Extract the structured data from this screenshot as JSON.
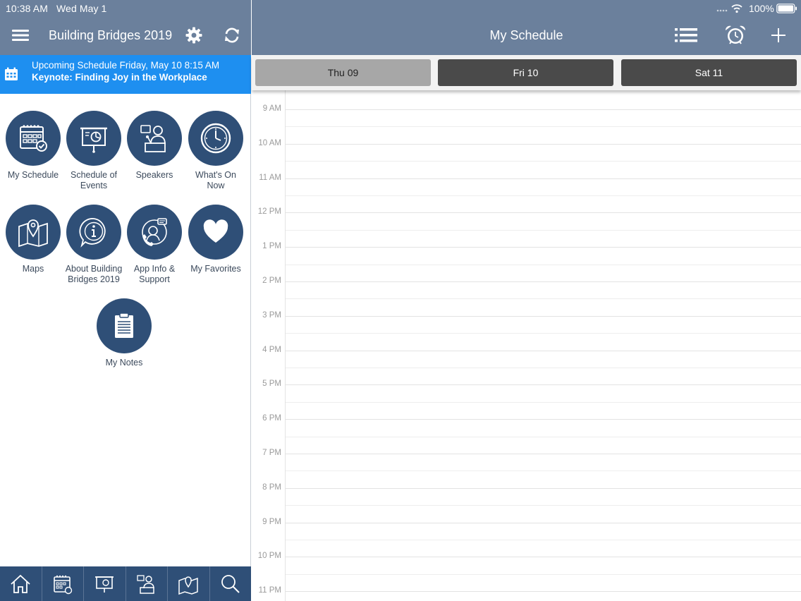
{
  "status_bar": {
    "time": "10:38 AM",
    "date": "Wed May 1",
    "battery": "100%"
  },
  "left_panel": {
    "app_title": "Building Bridges 2019",
    "banner": {
      "line1": "Upcoming Schedule Friday, May 10 8:15 AM",
      "line2": "Keynote: Finding Joy in the Workplace"
    },
    "tiles": [
      {
        "label": "My Schedule",
        "icon": "calendar-check-icon"
      },
      {
        "label": "Schedule of Events",
        "icon": "presentation-board-icon"
      },
      {
        "label": "Speakers",
        "icon": "speaker-podium-icon"
      },
      {
        "label": "What's On Now",
        "icon": "clock-icon"
      },
      {
        "label": "Maps",
        "icon": "map-pin-icon"
      },
      {
        "label": "About Building Bridges 2019",
        "icon": "info-icon"
      },
      {
        "label": "App Info & Support",
        "icon": "support-agent-icon"
      },
      {
        "label": "My Favorites",
        "icon": "heart-icon"
      },
      {
        "label": "My Notes",
        "icon": "notes-clipboard-icon"
      }
    ],
    "bottom_tabs": [
      {
        "icon": "home-icon"
      },
      {
        "icon": "calendar-icon"
      },
      {
        "icon": "presentation-icon"
      },
      {
        "icon": "speakers-icon"
      },
      {
        "icon": "map-icon"
      },
      {
        "icon": "search-icon"
      }
    ]
  },
  "right_panel": {
    "title": "My Schedule",
    "days": [
      {
        "label": "Thu 09",
        "selected": true
      },
      {
        "label": "Fri 10",
        "selected": false
      },
      {
        "label": "Sat 11",
        "selected": false
      }
    ],
    "hours": [
      "9 AM",
      "10 AM",
      "11 AM",
      "12 PM",
      "1 PM",
      "2 PM",
      "3 PM",
      "4 PM",
      "5 PM",
      "6 PM",
      "7 PM",
      "8 PM",
      "9 PM",
      "10 PM",
      "11 PM"
    ]
  },
  "colors": {
    "header": "#6b809c",
    "banner": "#1e8ff0",
    "tile": "#2f4f77",
    "day_selected": "#a7a7a7",
    "day_normal": "#4a4a4a"
  }
}
